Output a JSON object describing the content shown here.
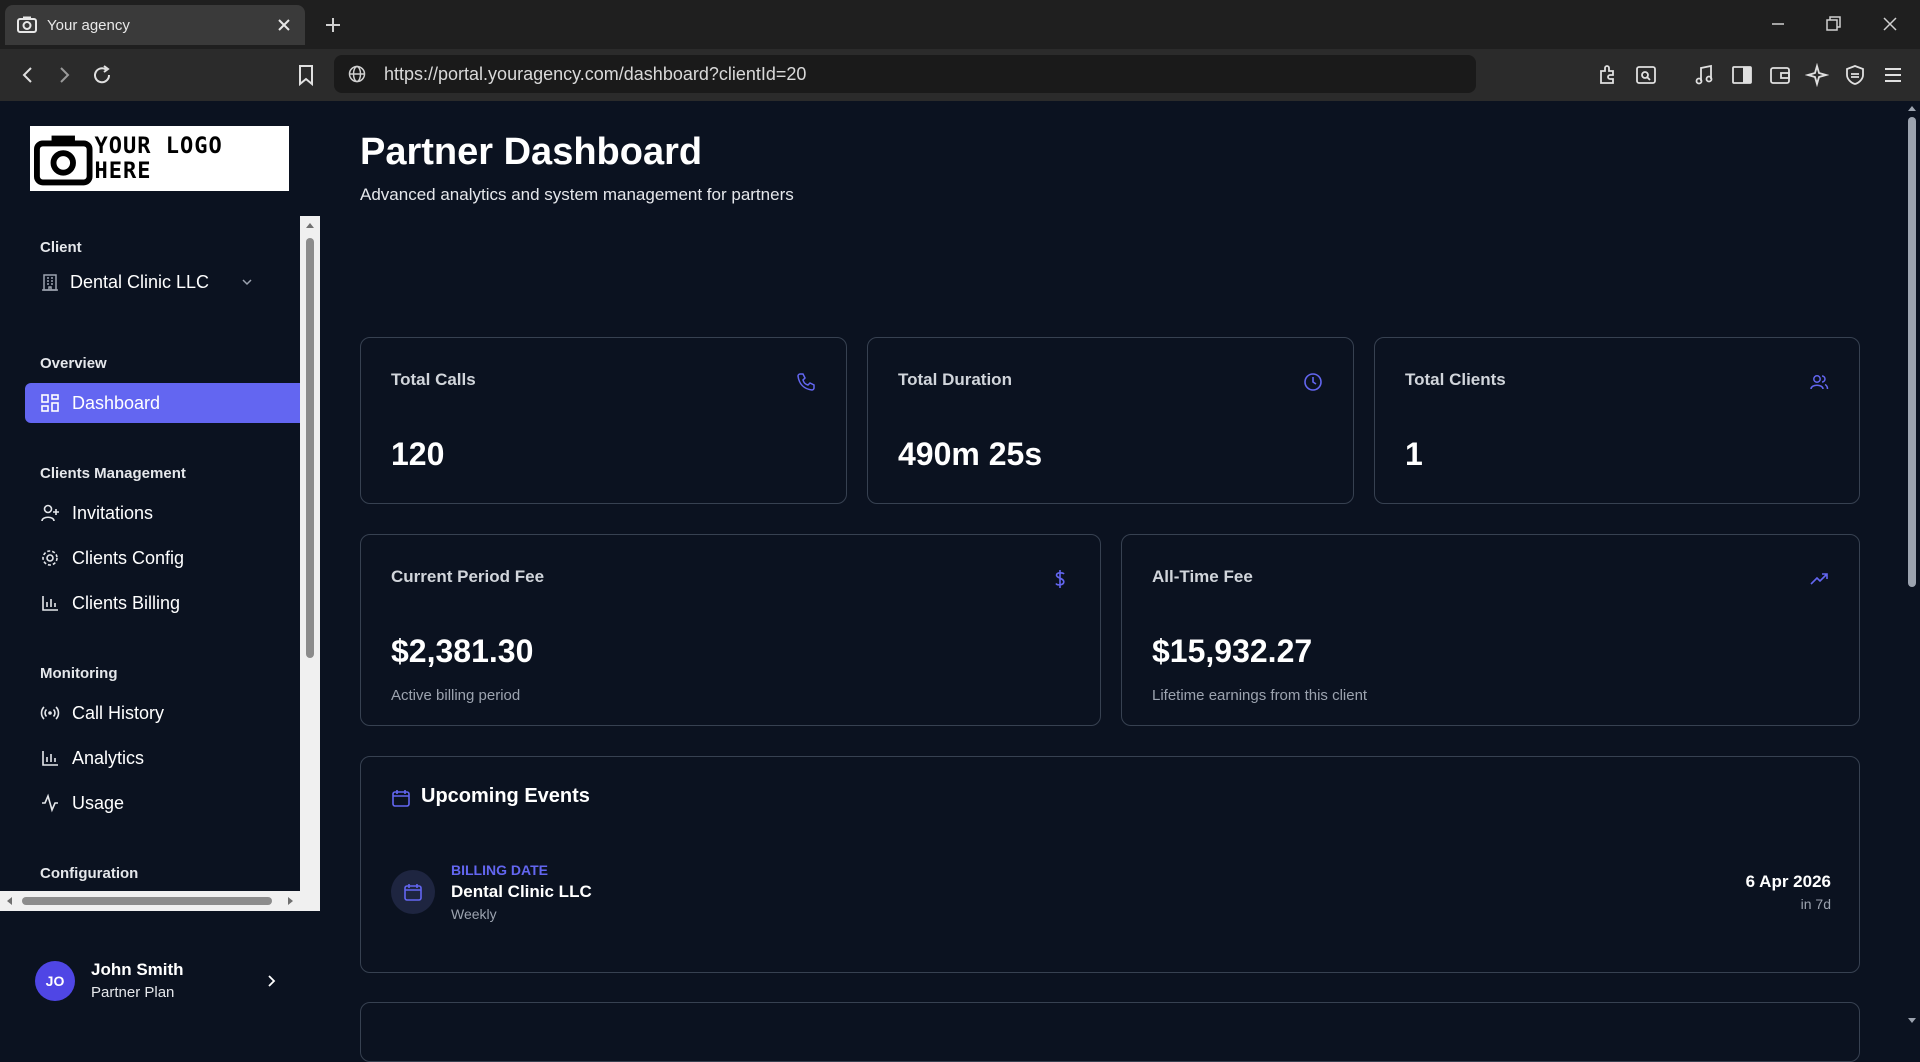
{
  "browser": {
    "tab_title": "Your agency",
    "url": "https://portal.youragency.com/dashboard?clientId=20"
  },
  "sidebar": {
    "logo_text": "YOUR LOGO HERE",
    "client_section": "Client",
    "client_name": "Dental Clinic LLC",
    "sections": {
      "overview": "Overview",
      "clients_management": "Clients Management",
      "monitoring": "Monitoring",
      "configuration": "Configuration"
    },
    "items": {
      "dashboard": "Dashboard",
      "invitations": "Invitations",
      "clients_config": "Clients Config",
      "clients_billing": "Clients Billing",
      "call_history": "Call History",
      "analytics": "Analytics",
      "usage": "Usage"
    },
    "user": {
      "initials": "JO",
      "name": "John Smith",
      "plan": "Partner Plan"
    }
  },
  "main": {
    "title": "Partner Dashboard",
    "subtitle": "Advanced analytics and system management for partners",
    "stats": {
      "total_calls": {
        "label": "Total Calls",
        "value": "120"
      },
      "total_duration": {
        "label": "Total Duration",
        "value": "490m 25s"
      },
      "total_clients": {
        "label": "Total Clients",
        "value": "1"
      },
      "current_fee": {
        "label": "Current Period Fee",
        "value": "$2,381.30",
        "note": "Active billing period"
      },
      "alltime_fee": {
        "label": "All-Time Fee",
        "value": "$15,932.27",
        "note": "Lifetime earnings from this client"
      }
    },
    "events": {
      "title": "Upcoming Events",
      "items": [
        {
          "type": "BILLING DATE",
          "name": "Dental Clinic LLC",
          "frequency": "Weekly",
          "date": "6 Apr 2026",
          "relative": "in 7d"
        }
      ]
    }
  },
  "colors": {
    "accent": "#6366f1",
    "background": "#0b1220",
    "card_border": "#374151"
  }
}
